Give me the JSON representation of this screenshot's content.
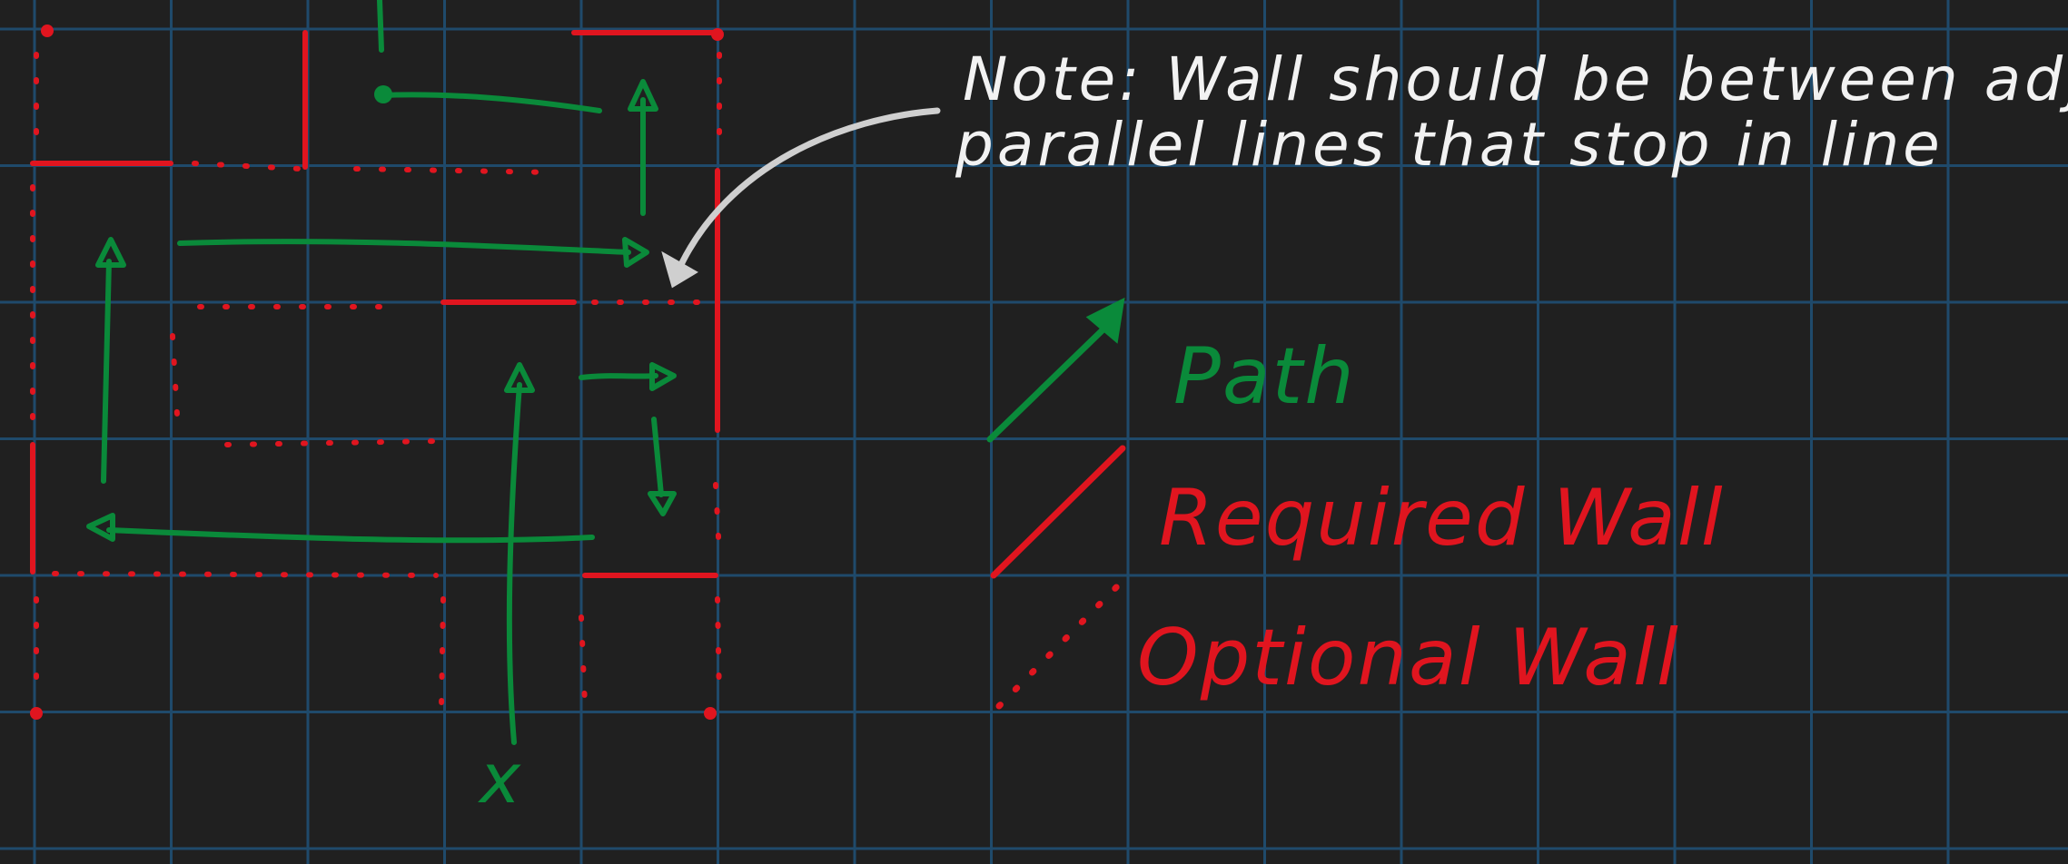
{
  "colors": {
    "background": "#202020",
    "grid": "#1f4a6b",
    "path": "#0a8a3a",
    "required_wall": "#e0151f",
    "optional_wall": "#e0151f",
    "note": "#f2f2f2",
    "note_arrow": "#cfcfcf"
  },
  "note": {
    "line1": "Note: Wall should be between adjacent",
    "line2": "parallel lines that stop in line"
  },
  "legend": {
    "path": "Path",
    "required_wall": "Required Wall",
    "optional_wall": "Optional Wall"
  },
  "start_marker": "x"
}
